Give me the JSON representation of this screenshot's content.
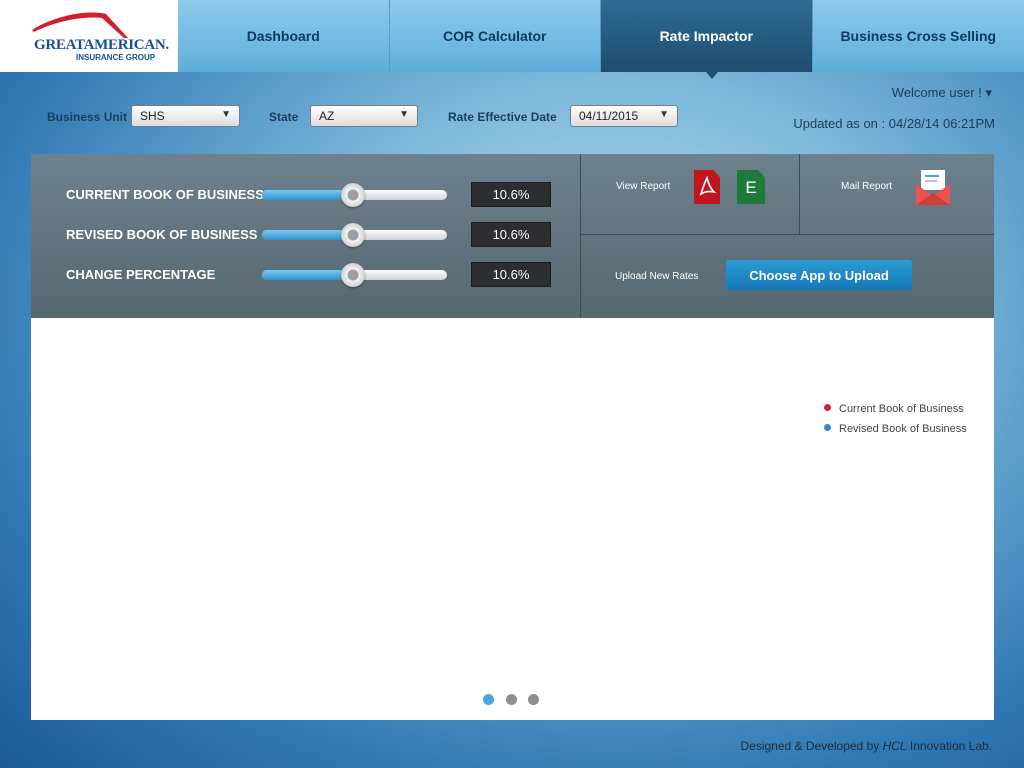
{
  "logo": {
    "line1": "GREATAMERICAN.",
    "line2": "INSURANCE GROUP",
    "brand_color": "#1a4f95",
    "swoosh_color": "#d0202e"
  },
  "nav": {
    "tabs": [
      {
        "label": "Dashboard",
        "active": false
      },
      {
        "label": "COR Calculator",
        "active": false
      },
      {
        "label": "Rate Impactor",
        "active": true
      },
      {
        "label": "Business Cross Selling",
        "active": false
      }
    ]
  },
  "filters": {
    "business_unit_label": "Business Unit",
    "business_unit_value": "SHS",
    "state_label": "State",
    "state_value": "AZ",
    "rate_date_label": "Rate Effective Date",
    "rate_date_value": "04/11/2015"
  },
  "user": {
    "welcome": "Welcome user ! ▾",
    "updated": "Updated as on : 04/28/14  06:21PM"
  },
  "sliders": [
    {
      "label": "CURRENT BOOK OF BUSINESS",
      "value_text": "10.6%",
      "fraction": 0.49
    },
    {
      "label": "REVISED BOOK OF BUSINESS",
      "value_text": "10.6%",
      "fraction": 0.49
    },
    {
      "label": "CHANGE PERCENTAGE",
      "value_text": "10.6%",
      "fraction": 0.49
    }
  ],
  "reports": {
    "view_report_label": "View Report",
    "excel_letter": "E",
    "mail_report_label": "Mail Report",
    "upload_label": "Upload New Rates",
    "upload_button": "Choose App to Upload"
  },
  "legend": [
    {
      "label": "Current Book of Business",
      "color": "#d4202f"
    },
    {
      "label": "Revised Book of Business",
      "color": "#2e8fcc"
    }
  ],
  "pager": {
    "count": 3,
    "active_index": 0,
    "active_color": "#4aa6de",
    "inactive_color": "#8a8f93"
  },
  "footer": {
    "prefix": "Designed & Developed by ",
    "company": "HCL",
    "suffix": " Innovation Lab."
  }
}
